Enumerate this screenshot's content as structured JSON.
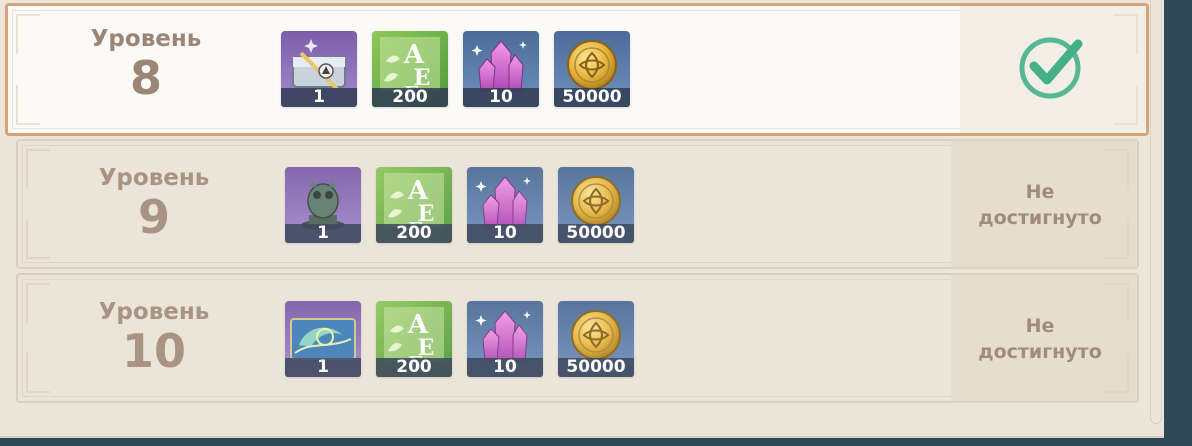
{
  "rows": [
    {
      "level_label": "Уровень",
      "level": "8",
      "state": "completed",
      "status_text": "",
      "items": [
        {
          "icon": "weapon-chest-icon",
          "count": "1"
        },
        {
          "icon": "talent-book-icon",
          "count": "200"
        },
        {
          "icon": "primogem-crystal-icon",
          "count": "10"
        },
        {
          "icon": "mora-coin-icon",
          "count": "50000"
        }
      ]
    },
    {
      "level_label": "Уровень",
      "level": "9",
      "state": "locked",
      "status_text": "Не достигнуто",
      "items": [
        {
          "icon": "owl-statue-icon",
          "count": "1"
        },
        {
          "icon": "talent-book-icon",
          "count": "200"
        },
        {
          "icon": "primogem-crystal-icon",
          "count": "10"
        },
        {
          "icon": "mora-coin-icon",
          "count": "50000"
        }
      ]
    },
    {
      "level_label": "Уровень",
      "level": "10",
      "state": "locked",
      "status_text": "Не достигнуто",
      "items": [
        {
          "icon": "namecard-icon",
          "count": "1"
        },
        {
          "icon": "talent-book-icon",
          "count": "200"
        },
        {
          "icon": "primogem-crystal-icon",
          "count": "10"
        },
        {
          "icon": "mora-coin-icon",
          "count": "50000"
        }
      ]
    }
  ],
  "colors": {
    "completed_border": "#d6a27a",
    "check_green": "#44b08a",
    "item_purple": "#8a70b8",
    "item_blue": "#5679a6",
    "item_green": "#7ab850"
  }
}
